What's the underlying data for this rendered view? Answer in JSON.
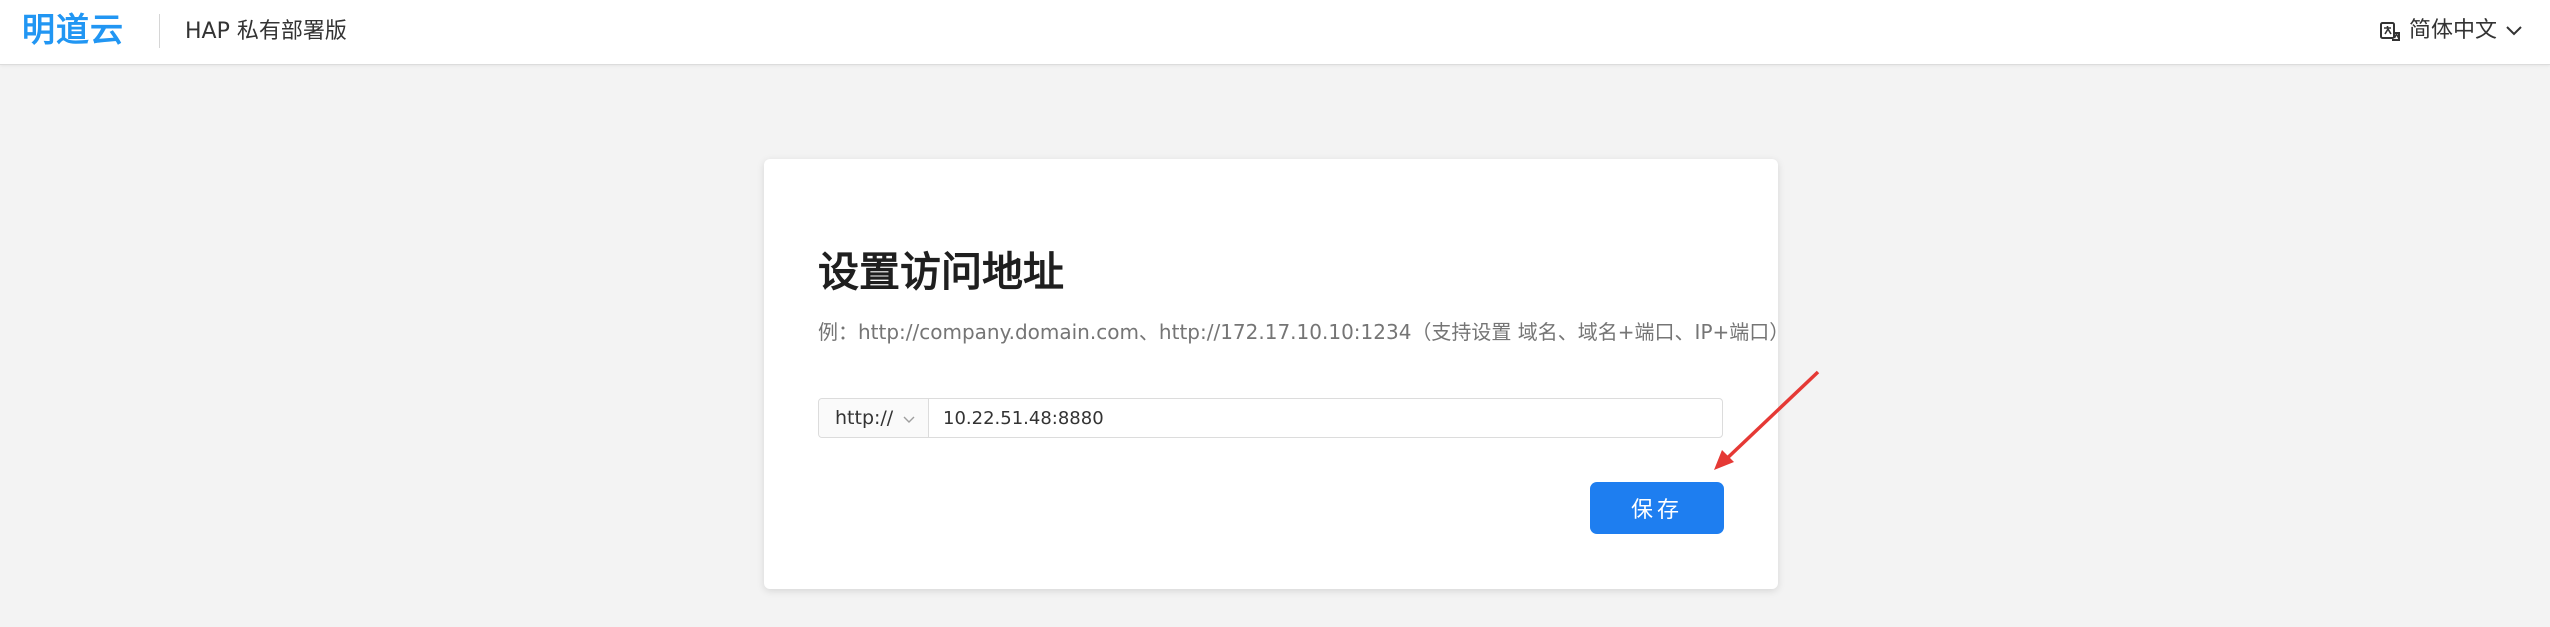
{
  "header": {
    "logo_text": "明道云",
    "product_name": "HAP 私有部署版",
    "language": "简体中文",
    "language_icon": "translate-icon",
    "chevron_icon": "chevron-down-icon"
  },
  "setup_card": {
    "title": "设置访问地址",
    "hint": "例：http://company.domain.com、http://172.17.10.10:1234（支持设置 域名、域名+端口、IP+端口）",
    "protocol": {
      "selected": "http://",
      "icon": "chevron-down-icon"
    },
    "address_value": "10.22.51.48:8880",
    "save_label": "保存"
  },
  "annotation": {
    "arrow_color": "#e53935"
  },
  "colors": {
    "accent": "#1e7ef0",
    "logo": "#2196f3",
    "background": "#f3f3f3"
  }
}
